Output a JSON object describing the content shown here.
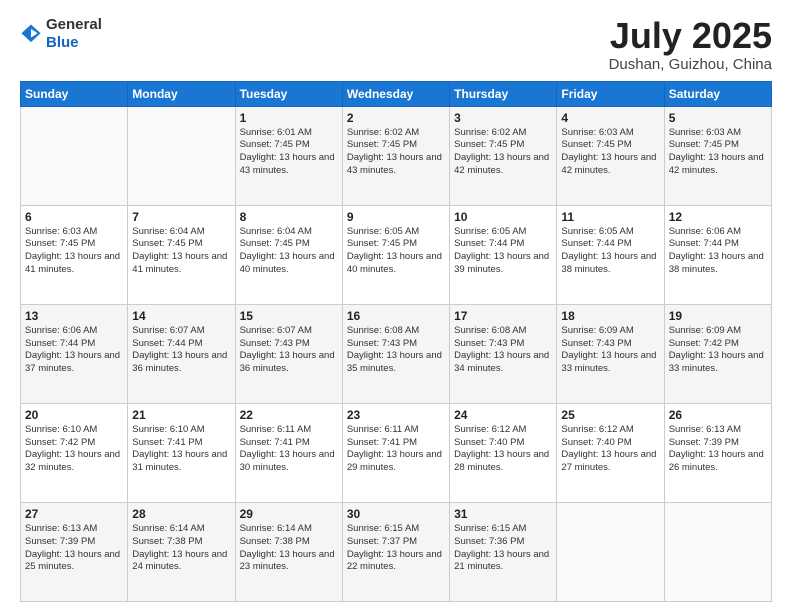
{
  "logo": {
    "general": "General",
    "blue": "Blue"
  },
  "header": {
    "title": "July 2025",
    "location": "Dushan, Guizhou, China"
  },
  "weekdays": [
    "Sunday",
    "Monday",
    "Tuesday",
    "Wednesday",
    "Thursday",
    "Friday",
    "Saturday"
  ],
  "weeks": [
    [
      {
        "day": "",
        "info": ""
      },
      {
        "day": "",
        "info": ""
      },
      {
        "day": "1",
        "info": "Sunrise: 6:01 AM\nSunset: 7:45 PM\nDaylight: 13 hours and 43 minutes."
      },
      {
        "day": "2",
        "info": "Sunrise: 6:02 AM\nSunset: 7:45 PM\nDaylight: 13 hours and 43 minutes."
      },
      {
        "day": "3",
        "info": "Sunrise: 6:02 AM\nSunset: 7:45 PM\nDaylight: 13 hours and 42 minutes."
      },
      {
        "day": "4",
        "info": "Sunrise: 6:03 AM\nSunset: 7:45 PM\nDaylight: 13 hours and 42 minutes."
      },
      {
        "day": "5",
        "info": "Sunrise: 6:03 AM\nSunset: 7:45 PM\nDaylight: 13 hours and 42 minutes."
      }
    ],
    [
      {
        "day": "6",
        "info": "Sunrise: 6:03 AM\nSunset: 7:45 PM\nDaylight: 13 hours and 41 minutes."
      },
      {
        "day": "7",
        "info": "Sunrise: 6:04 AM\nSunset: 7:45 PM\nDaylight: 13 hours and 41 minutes."
      },
      {
        "day": "8",
        "info": "Sunrise: 6:04 AM\nSunset: 7:45 PM\nDaylight: 13 hours and 40 minutes."
      },
      {
        "day": "9",
        "info": "Sunrise: 6:05 AM\nSunset: 7:45 PM\nDaylight: 13 hours and 40 minutes."
      },
      {
        "day": "10",
        "info": "Sunrise: 6:05 AM\nSunset: 7:44 PM\nDaylight: 13 hours and 39 minutes."
      },
      {
        "day": "11",
        "info": "Sunrise: 6:05 AM\nSunset: 7:44 PM\nDaylight: 13 hours and 38 minutes."
      },
      {
        "day": "12",
        "info": "Sunrise: 6:06 AM\nSunset: 7:44 PM\nDaylight: 13 hours and 38 minutes."
      }
    ],
    [
      {
        "day": "13",
        "info": "Sunrise: 6:06 AM\nSunset: 7:44 PM\nDaylight: 13 hours and 37 minutes."
      },
      {
        "day": "14",
        "info": "Sunrise: 6:07 AM\nSunset: 7:44 PM\nDaylight: 13 hours and 36 minutes."
      },
      {
        "day": "15",
        "info": "Sunrise: 6:07 AM\nSunset: 7:43 PM\nDaylight: 13 hours and 36 minutes."
      },
      {
        "day": "16",
        "info": "Sunrise: 6:08 AM\nSunset: 7:43 PM\nDaylight: 13 hours and 35 minutes."
      },
      {
        "day": "17",
        "info": "Sunrise: 6:08 AM\nSunset: 7:43 PM\nDaylight: 13 hours and 34 minutes."
      },
      {
        "day": "18",
        "info": "Sunrise: 6:09 AM\nSunset: 7:43 PM\nDaylight: 13 hours and 33 minutes."
      },
      {
        "day": "19",
        "info": "Sunrise: 6:09 AM\nSunset: 7:42 PM\nDaylight: 13 hours and 33 minutes."
      }
    ],
    [
      {
        "day": "20",
        "info": "Sunrise: 6:10 AM\nSunset: 7:42 PM\nDaylight: 13 hours and 32 minutes."
      },
      {
        "day": "21",
        "info": "Sunrise: 6:10 AM\nSunset: 7:41 PM\nDaylight: 13 hours and 31 minutes."
      },
      {
        "day": "22",
        "info": "Sunrise: 6:11 AM\nSunset: 7:41 PM\nDaylight: 13 hours and 30 minutes."
      },
      {
        "day": "23",
        "info": "Sunrise: 6:11 AM\nSunset: 7:41 PM\nDaylight: 13 hours and 29 minutes."
      },
      {
        "day": "24",
        "info": "Sunrise: 6:12 AM\nSunset: 7:40 PM\nDaylight: 13 hours and 28 minutes."
      },
      {
        "day": "25",
        "info": "Sunrise: 6:12 AM\nSunset: 7:40 PM\nDaylight: 13 hours and 27 minutes."
      },
      {
        "day": "26",
        "info": "Sunrise: 6:13 AM\nSunset: 7:39 PM\nDaylight: 13 hours and 26 minutes."
      }
    ],
    [
      {
        "day": "27",
        "info": "Sunrise: 6:13 AM\nSunset: 7:39 PM\nDaylight: 13 hours and 25 minutes."
      },
      {
        "day": "28",
        "info": "Sunrise: 6:14 AM\nSunset: 7:38 PM\nDaylight: 13 hours and 24 minutes."
      },
      {
        "day": "29",
        "info": "Sunrise: 6:14 AM\nSunset: 7:38 PM\nDaylight: 13 hours and 23 minutes."
      },
      {
        "day": "30",
        "info": "Sunrise: 6:15 AM\nSunset: 7:37 PM\nDaylight: 13 hours and 22 minutes."
      },
      {
        "day": "31",
        "info": "Sunrise: 6:15 AM\nSunset: 7:36 PM\nDaylight: 13 hours and 21 minutes."
      },
      {
        "day": "",
        "info": ""
      },
      {
        "day": "",
        "info": ""
      }
    ]
  ]
}
